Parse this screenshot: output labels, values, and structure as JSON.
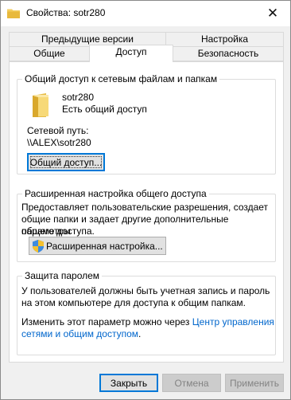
{
  "window": {
    "title": "Свойства: sotr280",
    "close_glyph": "✕"
  },
  "tabs": {
    "row1": [
      "Предыдущие версии",
      "Настройка"
    ],
    "row2": [
      "Общие",
      "Доступ",
      "Безопасность"
    ],
    "active": "Доступ"
  },
  "sharing": {
    "group_title": "Общий доступ к сетевым файлам и папкам",
    "folder_name": "sotr280",
    "folder_status": "Есть общий доступ",
    "network_path_label": "Сетевой путь:",
    "network_path": "\\\\ALEX\\sotr280",
    "share_button": "Общий доступ..."
  },
  "advanced": {
    "group_title": "Расширенная настройка общего доступа",
    "description": [
      "Предоставляет пользовательские разрешения, создает",
      "общие папки и задает другие дополнительные параметры",
      "общего доступа."
    ],
    "button": "Расширенная настройка..."
  },
  "password": {
    "group_title": "Защита паролем",
    "description": [
      "У пользователей должны быть учетная запись и пароль",
      "на этом компьютере для доступа к общим папкам."
    ],
    "change_text": "Изменить этот параметр можно через ",
    "link_line1": "Центр управления",
    "link_line2": "сетями и общим доступом",
    "period": "."
  },
  "footer": {
    "ok": "Закрыть",
    "cancel": "Отмена",
    "apply": "Применить"
  },
  "colors": {
    "accent": "#0078d7",
    "link": "#0066cc",
    "folder": "#e8c14a"
  },
  "icons": [
    "folder-icon",
    "close-icon",
    "shield-icon"
  ]
}
